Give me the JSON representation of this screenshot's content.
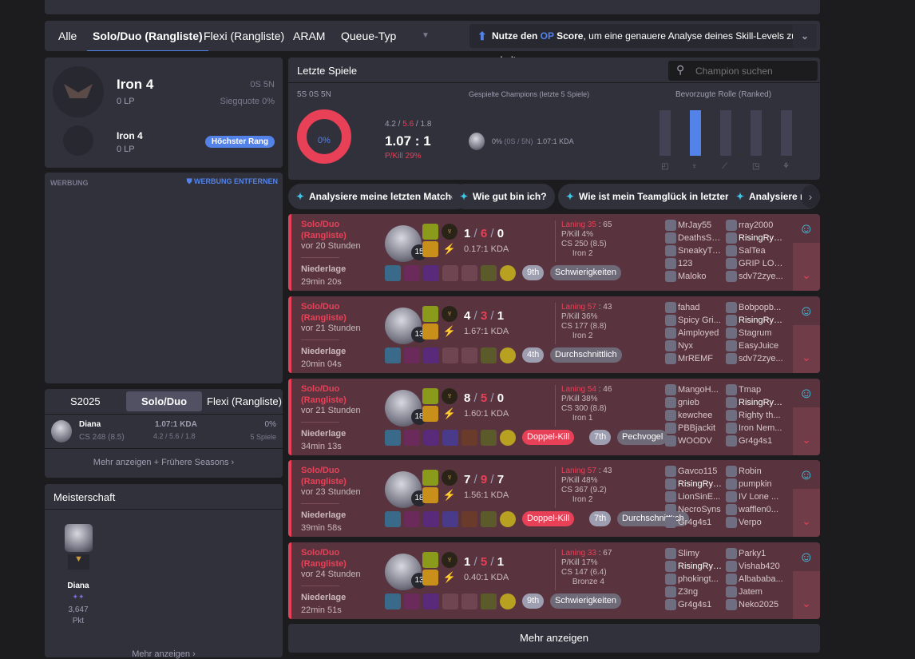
{
  "tabs": {
    "items": [
      "Alle",
      "Solo/Duo (Rangliste)",
      "Flexi (Rangliste)",
      "ARAM",
      "Queue-Typ"
    ],
    "op_pre": "Nutze den ",
    "op_op": "OP",
    "op_score": " Score",
    "op_post": ", um eine genauere Analyse deines Skill-Levels zu erhalten."
  },
  "rank": {
    "tier": "Iron 4",
    "lp": "0 LP",
    "record": "0S 5N",
    "winrate": "Siegquote 0%",
    "peak_tier": "Iron 4",
    "peak_lp": "0 LP",
    "peak_badge": "Höchster Rang"
  },
  "ad": {
    "label": "WERBUNG",
    "remove": "WERBUNG ENTFERNEN"
  },
  "season": {
    "tabs": [
      "S2025",
      "Solo/Duo (Ran...",
      "Flexi (Rangliste)"
    ],
    "champ": "Diana",
    "cs": "CS 248 (8.5)",
    "kda": "1.07:1 KDA",
    "kda_detail": "4.2 / 5.6 / 1.8",
    "wr": "0%",
    "games": "5 Spiele",
    "more": "Mehr anzeigen + Frühere Seasons"
  },
  "mastery": {
    "title": "Meisterschaft",
    "champ": "Diana",
    "points": "3,647",
    "unit": "Pkt",
    "more": "Mehr anzeigen"
  },
  "recent": {
    "title": "Letzte Spiele",
    "search_placeholder": "Champion suchen",
    "record": "5S 0S 5N",
    "winrate": "0%",
    "winrate_value": 0,
    "k": "4.2",
    "d": "5.6",
    "a": "1.8",
    "ratio": "1.07 : 1",
    "pkill": "P/Kill 29%",
    "played_label": "Gespielte Champions (letzte 5 Spiele)",
    "champ_wr": "0%",
    "champ_rec": "(0S / 5N)",
    "champ_kda": "1.07:1 KDA",
    "role_label": "Bevorzugte Rolle (Ranked)",
    "roles": [
      {
        "name": "top",
        "value": 0
      },
      {
        "name": "jungle",
        "value": 1
      },
      {
        "name": "mid",
        "value": 0
      },
      {
        "name": "adc",
        "value": 0
      },
      {
        "name": "support",
        "value": 0
      }
    ]
  },
  "chips": [
    "Analysiere meine letzten Matches",
    "Wie gut bin ich?",
    "Wie ist mein Teamglück in letzter Zeit?",
    "Analysiere me"
  ],
  "colors": {
    "loss": "#e84057",
    "accent": "#5383e8",
    "ai": "#3ec7e8"
  },
  "matches": [
    {
      "queue": "Solo/Duo (Rangliste)",
      "ago": "vor 20 Stunden",
      "result": "Niederlage",
      "duration": "29min 20s",
      "level": "15",
      "k": "1",
      "d": "6",
      "a": "0",
      "kda": "0.17:1 KDA",
      "laning": "Laning 35",
      "laning_opp": "65",
      "pkill": "P/Kill 4%",
      "cs": "CS 250 (8.5)",
      "rank": "Iron 2",
      "items": 5,
      "badges": [
        {
          "t": "9th",
          "c": ""
        },
        {
          "t": "Schwierigkeiten",
          "c": "grey"
        }
      ],
      "team1": [
        "MrJay55",
        "DeathsSh...",
        "SneakyTu...",
        "123",
        "Maloko"
      ],
      "team2": [
        "rray2000",
        "RisingRyz...",
        "SalTea",
        "GRIP LORD",
        "sdv72zye..."
      ],
      "me": [
        2,
        1
      ]
    },
    {
      "queue": "Solo/Duo (Rangliste)",
      "ago": "vor 21 Stunden",
      "result": "Niederlage",
      "duration": "20min 04s",
      "level": "13",
      "k": "4",
      "d": "3",
      "a": "1",
      "kda": "1.67:1 KDA",
      "laning": "Laning 57",
      "laning_opp": "43",
      "pkill": "P/Kill 36%",
      "cs": "CS 177 (8.8)",
      "rank": "Iron 2",
      "items": 5,
      "badges": [
        {
          "t": "4th",
          "c": ""
        },
        {
          "t": "Durchschnittlich",
          "c": "grey"
        }
      ],
      "team1": [
        "fahad",
        "Spicy Gri...",
        "Aimployed",
        "Nyx",
        "MrREMF"
      ],
      "team2": [
        "Bobpopb...",
        "RisingRyz...",
        "Stagrum",
        "EasyJuice",
        "sdv72zye..."
      ],
      "me": [
        2,
        1
      ]
    },
    {
      "queue": "Solo/Duo (Rangliste)",
      "ago": "vor 21 Stunden",
      "result": "Niederlage",
      "duration": "34min 13s",
      "level": "18",
      "k": "8",
      "d": "5",
      "a": "0",
      "kda": "1.60:1 KDA",
      "laning": "Laning 54",
      "laning_opp": "46",
      "pkill": "P/Kill 38%",
      "cs": "CS 300 (8.8)",
      "rank": "Iron 1",
      "items": 7,
      "badges": [
        {
          "t": "Doppel-Kill",
          "c": "red"
        },
        {
          "t": "7th",
          "c": ""
        },
        {
          "t": "Pechvogel",
          "c": "grey"
        }
      ],
      "team1": [
        "MangoH...",
        "gnieb",
        "kewchee",
        "PBBjackit",
        "WOODV"
      ],
      "team2": [
        "Tmap",
        "RisingRyz...",
        "Righty th...",
        "Iron Nem...",
        "Gr4g4s1"
      ],
      "me": [
        2,
        1
      ]
    },
    {
      "queue": "Solo/Duo (Rangliste)",
      "ago": "vor 23 Stunden",
      "result": "Niederlage",
      "duration": "39min 58s",
      "level": "18",
      "k": "7",
      "d": "9",
      "a": "7",
      "kda": "1.56:1 KDA",
      "laning": "Laning 57",
      "laning_opp": "43",
      "pkill": "P/Kill 48%",
      "cs": "CS 367 (9.2)",
      "rank": "Iron 2",
      "items": 7,
      "badges": [
        {
          "t": "Doppel-Kill",
          "c": "red"
        },
        {
          "t": "7th",
          "c": ""
        },
        {
          "t": "Durchschnittlich",
          "c": "grey"
        }
      ],
      "team1": [
        "Gavco115",
        "RisingRyz...",
        "LionSinE...",
        "NecroSyns",
        "Gr4g4s1"
      ],
      "team2": [
        "Robin",
        "pumpkin",
        "IV Lone ...",
        "wafflen0...",
        "Verpo"
      ],
      "me": [
        1,
        1
      ]
    },
    {
      "queue": "Solo/Duo (Rangliste)",
      "ago": "vor 24 Stunden",
      "result": "Niederlage",
      "duration": "22min 51s",
      "level": "13",
      "k": "1",
      "d": "5",
      "a": "1",
      "kda": "0.40:1 KDA",
      "laning": "Laning 33",
      "laning_opp": "67",
      "pkill": "P/Kill 17%",
      "cs": "CS 147 (6.4)",
      "rank": "Bronze 4",
      "items": 5,
      "badges": [
        {
          "t": "9th",
          "c": ""
        },
        {
          "t": "Schwierigkeiten",
          "c": "grey"
        }
      ],
      "team1": [
        "Slimy",
        "RisingRyz...",
        "phokingt...",
        "Z3ng",
        "Gr4g4s1"
      ],
      "team2": [
        "Parky1",
        "Vishab420",
        "Albababa...",
        "Jatem",
        "Neko2025"
      ],
      "me": [
        1,
        1
      ]
    }
  ],
  "more_label": "Mehr anzeigen"
}
